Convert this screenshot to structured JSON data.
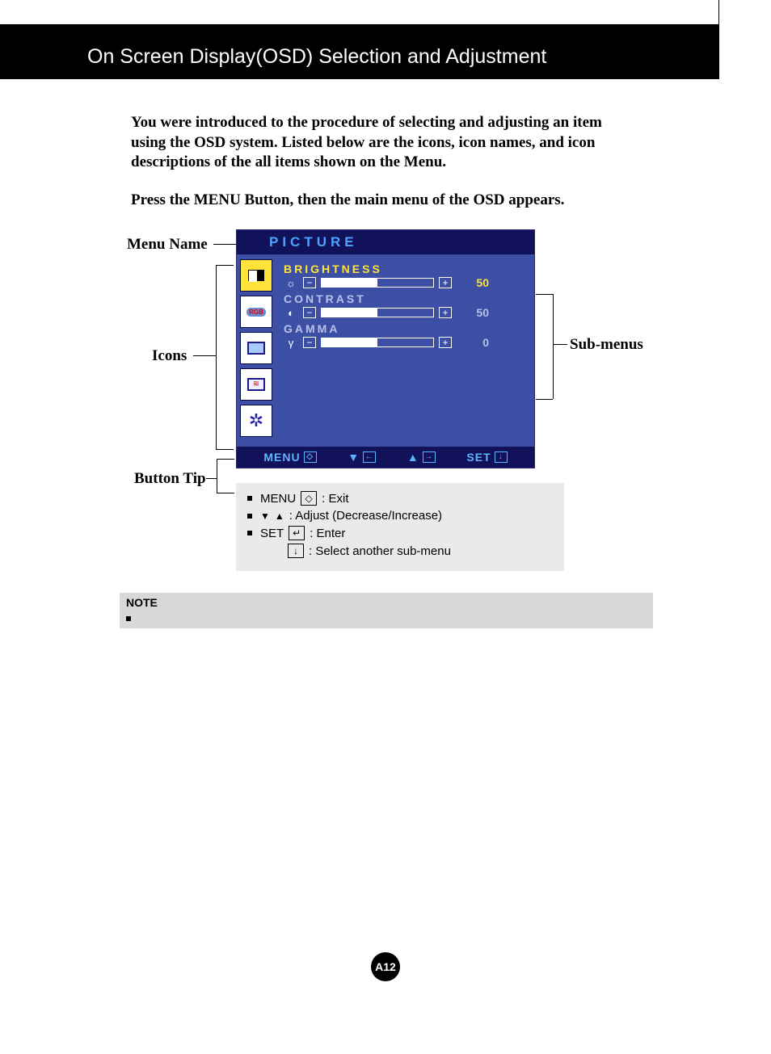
{
  "header": {
    "title": "On Screen Display(OSD) Selection and Adjustment"
  },
  "intro": {
    "p1": "You were introduced to the procedure of selecting and adjusting an item using the OSD system.  Listed below are the icons, icon names, and icon descriptions of the all items shown on the Menu.",
    "p2": "Press the MENU Button, then the main menu of the OSD appears."
  },
  "labels": {
    "menu_name": "Menu Name",
    "icons": "Icons",
    "button_tip": "Button Tip",
    "submenus": "Sub-menus"
  },
  "osd": {
    "title": "PICTURE",
    "submenus": [
      {
        "label": "BRIGHTNESS",
        "value": "50",
        "fill": 50,
        "icon": "☼",
        "highlight": true
      },
      {
        "label": "CONTRAST",
        "value": "50",
        "fill": 50,
        "icon": "◐",
        "highlight": false
      },
      {
        "label": "GAMMA",
        "value": "0",
        "fill": 50,
        "icon": "γ",
        "highlight": false
      }
    ],
    "footer": {
      "menu": "MENU",
      "set": "SET"
    }
  },
  "tips": {
    "t1a": "MENU",
    "t1b": ": Exit",
    "t2": ": Adjust (Decrease/Increase)",
    "t3a": "SET",
    "t3b": ": Enter",
    "t4": ": Select another sub-menu"
  },
  "note": {
    "title": "NOTE"
  },
  "page": "A12"
}
